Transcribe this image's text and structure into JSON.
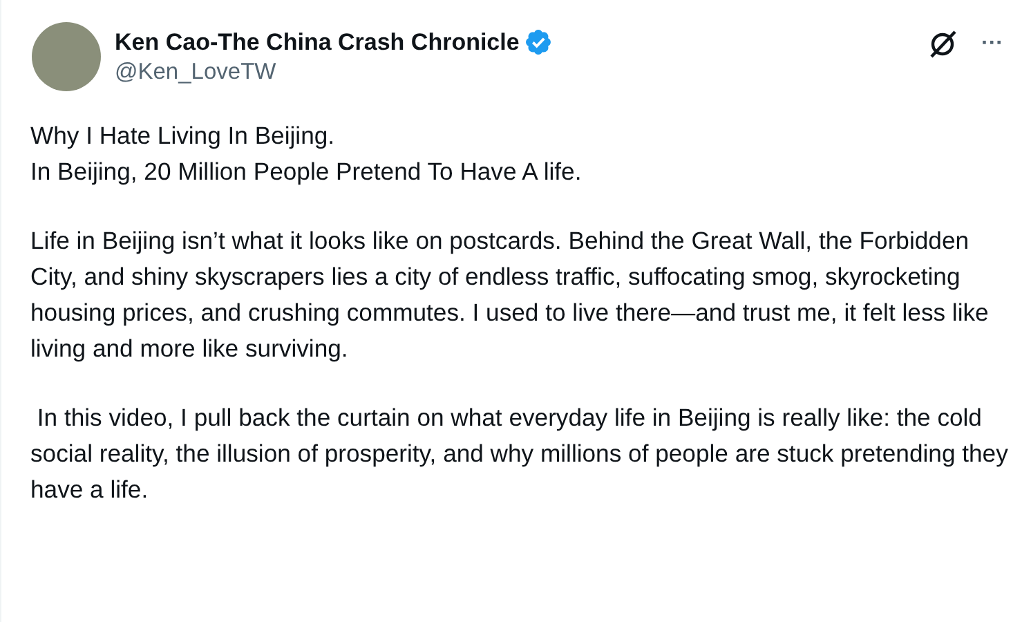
{
  "author": {
    "name": "Ken Cao-The China Crash Chronicle",
    "verified": true,
    "handle": "@Ken_LoveTW"
  },
  "post": {
    "paragraphs": [
      "Why I Hate Living In Beijing.\nIn Beijing, 20 Million People Pretend To Have A life.",
      "Life in Beijing isn’t what it looks like on postcards. Behind the Great Wall, the Forbidden City, and shiny skyscrapers lies a city of endless traffic, suffocating smog, skyrocketing housing prices, and crushing commutes. I used to live there—and trust me, it felt less like living and more like surviving.",
      " In this video, I pull back the curtain on what everyday life in Beijing is really like: the cold social reality, the illusion of prosperity, and why millions of people are stuck pretending they have a life."
    ]
  },
  "more_menu": "···"
}
